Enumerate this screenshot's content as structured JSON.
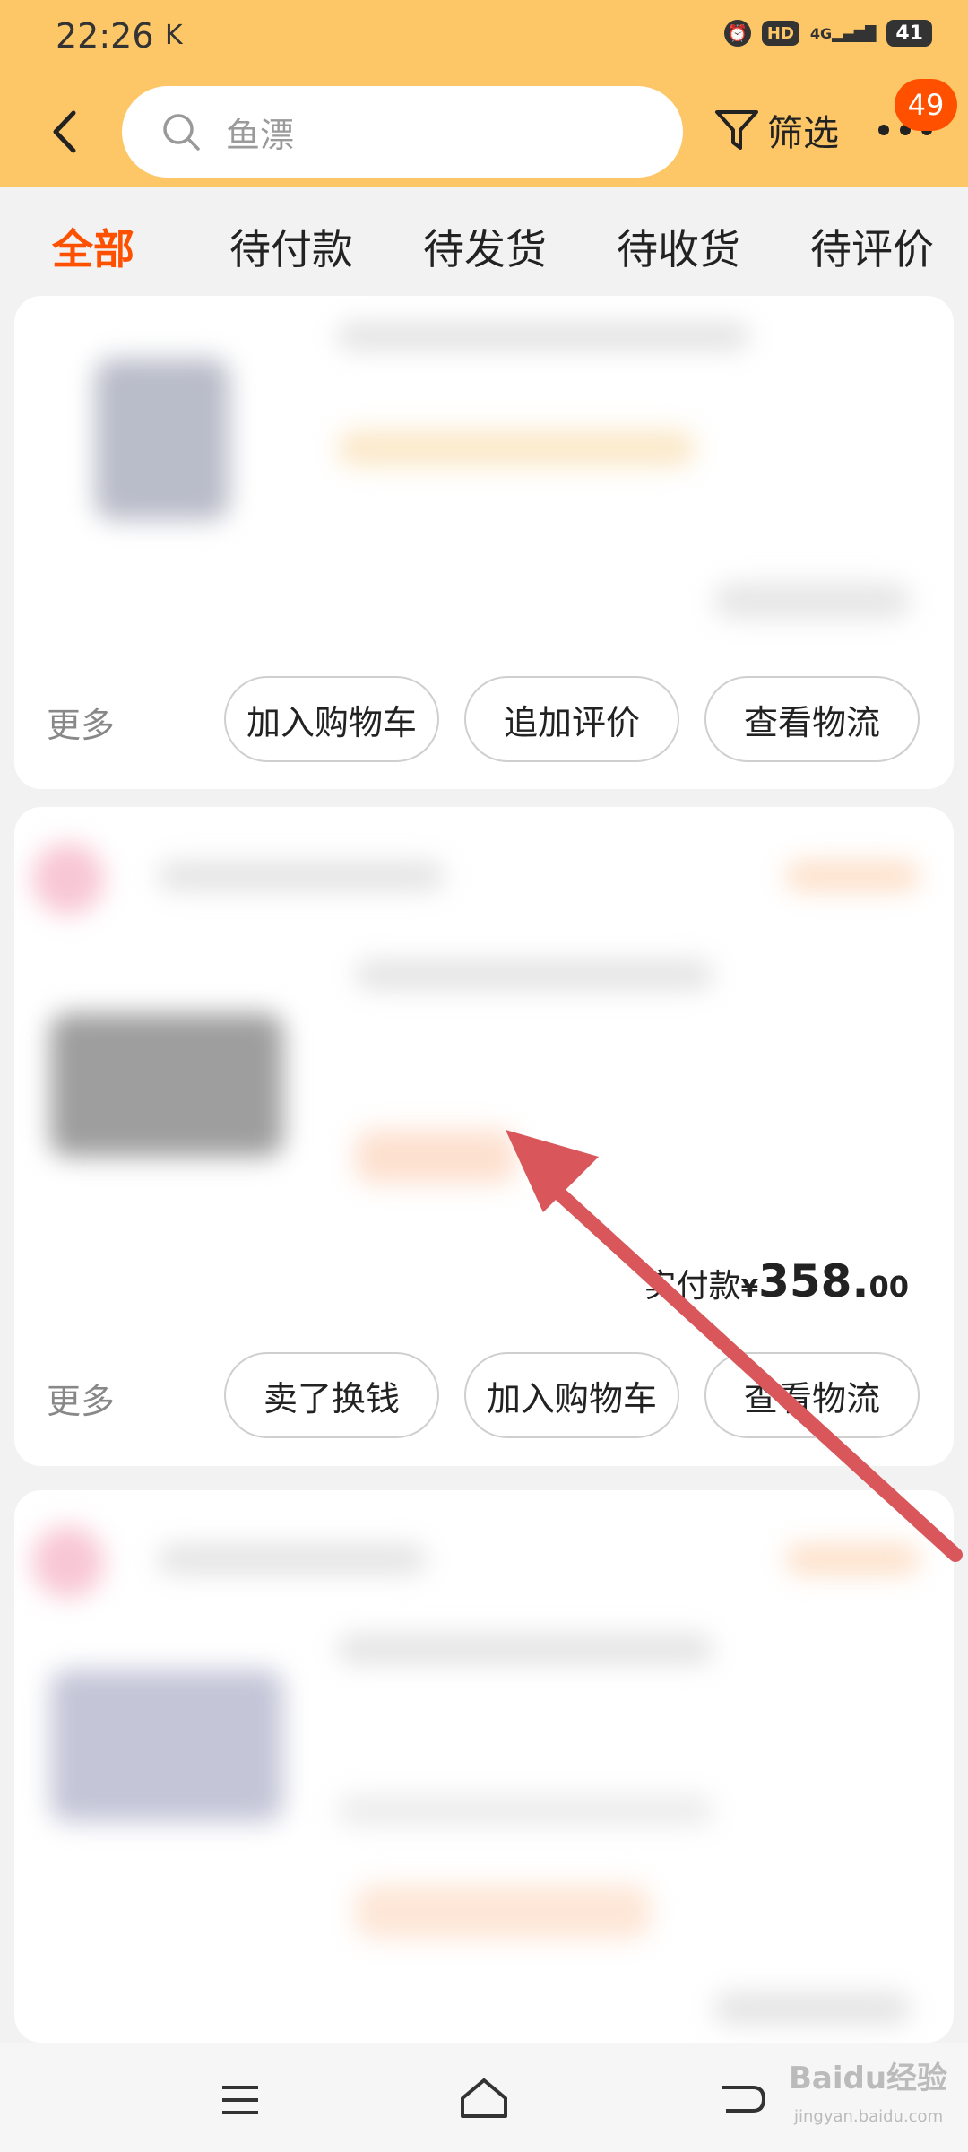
{
  "status_bar": {
    "time": "22:26",
    "k_indicator": "K",
    "hd": "HD",
    "network": "4G",
    "battery": "41"
  },
  "header": {
    "search_placeholder": "鱼漂",
    "filter_label": "筛选",
    "notification_count": "49"
  },
  "tabs": [
    {
      "label": "全部",
      "active": true
    },
    {
      "label": "待付款"
    },
    {
      "label": "待发货"
    },
    {
      "label": "待收货"
    },
    {
      "label": "待评价"
    }
  ],
  "orders": [
    {
      "more_label": "更多",
      "actions": [
        "加入购物车",
        "追加评价",
        "查看物流"
      ]
    },
    {
      "more_label": "更多",
      "price_label": "实付款",
      "currency": "¥",
      "price_int": "358.",
      "price_dec": "00",
      "actions": [
        "卖了换钱",
        "加入购物车",
        "查看物流"
      ]
    }
  ],
  "watermark": {
    "text": "Baidu经验",
    "sub": "jingyan.baidu.com"
  },
  "colors": {
    "header_bg": "#fdc767",
    "accent": "#ff5000",
    "arrow": "#d9575b"
  }
}
